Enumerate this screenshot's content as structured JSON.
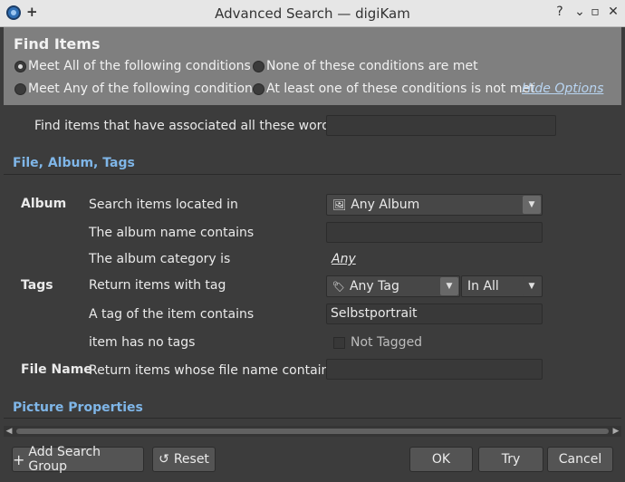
{
  "window": {
    "title": "Advanced Search — digiKam"
  },
  "header": {
    "title": "Find Items",
    "options": {
      "meet_all": "Meet All of the following conditions",
      "none_met": "None of these conditions are met",
      "meet_any": "Meet Any of the following conditions",
      "one_not_met": "At least one of these conditions is not met",
      "selected": "meet_all"
    },
    "hide_options_label": "Hide Options"
  },
  "words": {
    "label": "Find items that have associated all these words:",
    "value": ""
  },
  "sections": {
    "file": "File, Album, Tags",
    "picture": "Picture Properties"
  },
  "album": {
    "group_label": "Album",
    "location_label": "Search items located in",
    "location_value": "Any Album",
    "name_contains_label": "The album name contains",
    "name_contains_value": "",
    "category_label": "The album category is",
    "category_value": "Any"
  },
  "tags": {
    "group_label": "Tags",
    "with_tag_label": "Return items with tag",
    "tag_value": "Any Tag",
    "tag_mode": "In All",
    "contains_label": "A tag of the item contains",
    "contains_value": "Selbstportrait",
    "no_tags_label": "item has no tags",
    "not_tagged_label": "Not Tagged"
  },
  "filename": {
    "group_label": "File Name",
    "label": "Return items whose file name contains",
    "value": ""
  },
  "footer": {
    "add_group": "Add Search Group",
    "reset": "Reset",
    "ok": "OK",
    "try": "Try",
    "cancel": "Cancel"
  },
  "icons": {
    "app": "digikam-icon",
    "album": "image-icon",
    "tag": "tag-icon"
  }
}
